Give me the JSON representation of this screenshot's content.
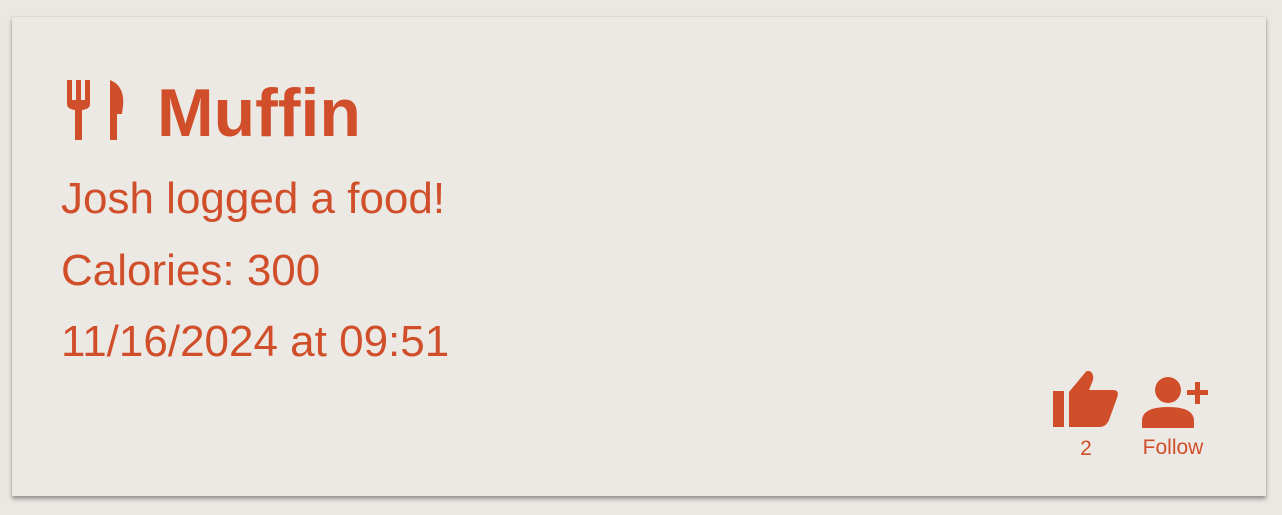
{
  "post": {
    "title": "Muffin",
    "title_icon": "fork-knife-icon",
    "message": "Josh logged a food!",
    "calories": "Calories: 300",
    "timestamp": "11/16/2024 at 09:51"
  },
  "actions": {
    "like": {
      "icon": "thumb-up-icon",
      "count": "2"
    },
    "follow": {
      "icon": "person-add-icon",
      "label": "Follow"
    }
  },
  "colors": {
    "accent": "#d04f2a",
    "card_background": "#ece9e4",
    "page_background": "#ebe8e3"
  }
}
